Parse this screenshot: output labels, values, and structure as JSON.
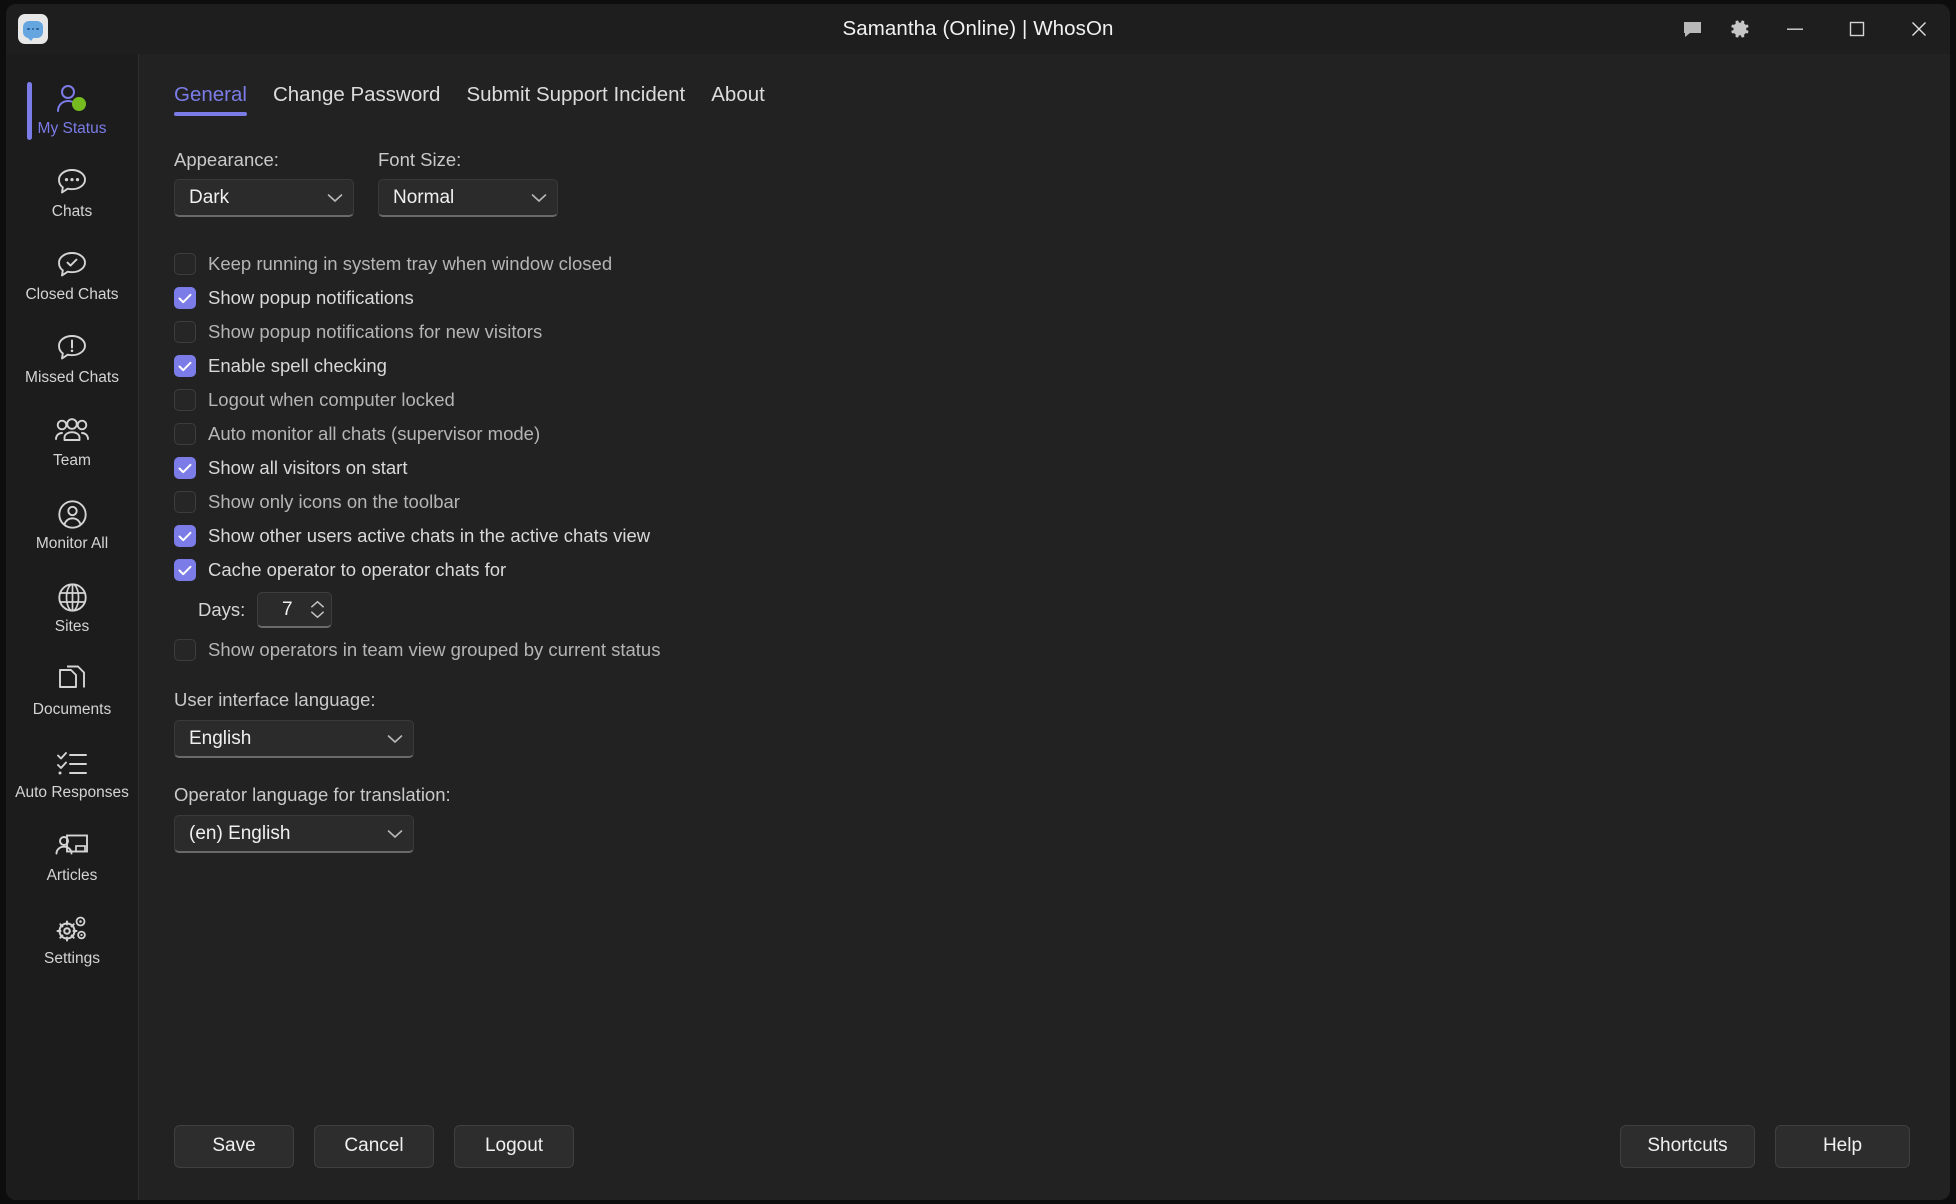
{
  "titlebar": {
    "title": "Samantha (Online)  | WhosOn",
    "app_icon": "chat-bubble-app-icon",
    "controls": [
      {
        "name": "feedback-icon",
        "glyph": "speech-bubble"
      },
      {
        "name": "gear-icon",
        "glyph": "gear"
      },
      {
        "name": "minimize-icon",
        "glyph": "minimize"
      },
      {
        "name": "maximize-icon",
        "glyph": "maximize"
      },
      {
        "name": "close-icon",
        "glyph": "close"
      }
    ]
  },
  "sidebar": {
    "items": [
      {
        "label": "My Status",
        "icon": "person-status-icon",
        "active": true
      },
      {
        "label": "Chats",
        "icon": "chat-bubble-icon",
        "active": false
      },
      {
        "label": "Closed Chats",
        "icon": "chat-check-icon",
        "active": false
      },
      {
        "label": "Missed Chats",
        "icon": "chat-alert-icon",
        "active": false
      },
      {
        "label": "Team",
        "icon": "people-group-icon",
        "active": false
      },
      {
        "label": "Monitor All",
        "icon": "person-circle-icon",
        "active": false
      },
      {
        "label": "Sites",
        "icon": "globe-icon",
        "active": false
      },
      {
        "label": "Documents",
        "icon": "documents-icon",
        "active": false
      },
      {
        "label": "Auto Responses",
        "icon": "checklist-icon",
        "active": false
      },
      {
        "label": "Articles",
        "icon": "article-person-icon",
        "active": false
      },
      {
        "label": "Settings",
        "icon": "gears-icon",
        "active": false
      }
    ]
  },
  "tabs": [
    {
      "label": "General",
      "active": true
    },
    {
      "label": "Change Password",
      "active": false
    },
    {
      "label": "Submit Support Incident",
      "active": false
    },
    {
      "label": "About",
      "active": false
    }
  ],
  "form": {
    "appearance": {
      "label": "Appearance:",
      "value": "Dark"
    },
    "font_size": {
      "label": "Font Size:",
      "value": "Normal"
    },
    "checkboxes": [
      {
        "label": "Keep running in system tray when window closed",
        "checked": false
      },
      {
        "label": "Show popup notifications",
        "checked": true
      },
      {
        "label": "Show popup notifications for new visitors",
        "checked": false
      },
      {
        "label": "Enable spell checking",
        "checked": true
      },
      {
        "label": "Logout when computer locked",
        "checked": false
      },
      {
        "label": "Auto monitor all chats (supervisor mode)",
        "checked": false
      },
      {
        "label": "Show all visitors on start",
        "checked": true
      },
      {
        "label": "Show only icons on the toolbar",
        "checked": false
      },
      {
        "label": "Show other users active chats in the active chats view",
        "checked": true
      },
      {
        "label": "Cache operator to operator chats for",
        "checked": true
      }
    ],
    "days": {
      "label": "Days:",
      "value": "7"
    },
    "grouped_checkbox": {
      "label": "Show operators in team view grouped by current status",
      "checked": false
    },
    "ui_language": {
      "label": "User interface language:",
      "value": "English"
    },
    "operator_language": {
      "label": "Operator language for translation:",
      "value": "(en) English"
    }
  },
  "footer": {
    "save": "Save",
    "cancel": "Cancel",
    "logout": "Logout",
    "shortcuts": "Shortcuts",
    "help": "Help"
  },
  "colors": {
    "accent": "#7b7ce8",
    "window_bg": "#1c1c1c",
    "content_bg": "#222222",
    "status_online": "#76bc21"
  }
}
